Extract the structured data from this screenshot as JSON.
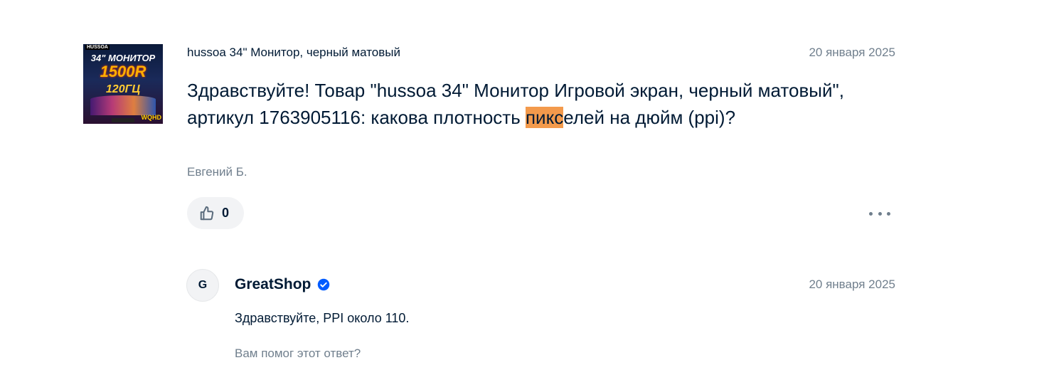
{
  "question": {
    "product_title": "hussoa 34\" Монитор, черный матовый",
    "date": "20 января 2025",
    "text_before": "Здравствуйте! Товар \"hussoa 34\" Монитор Игровой экран, черный матовый\", артикул 1763905116: какова плотность ",
    "text_highlight": "пикс",
    "text_after": "елей на дюйм (ppi)?",
    "author": "Евгений Б.",
    "like_count": "0",
    "product_image": {
      "brand": "HUSSOA",
      "line1": "34\" МОНИТОР",
      "line2": "1500R",
      "line3": "120ГЦ",
      "badge": "WQHD"
    }
  },
  "answer": {
    "avatar_letter": "G",
    "shop_name": "GreatShop",
    "date": "20 января 2025",
    "text": "Здравствуйте, PPI около 110.",
    "helpful_prompt": "Вам помог этот ответ?"
  },
  "icons": {
    "like": "thumbs-up-icon",
    "more": "more-dots-icon",
    "verified": "verified-check-icon"
  },
  "colors": {
    "text": "#001a34",
    "muted": "#707f8d",
    "highlight": "#f39a4c",
    "verified": "#005bff",
    "button_bg": "#f2f3f5"
  }
}
